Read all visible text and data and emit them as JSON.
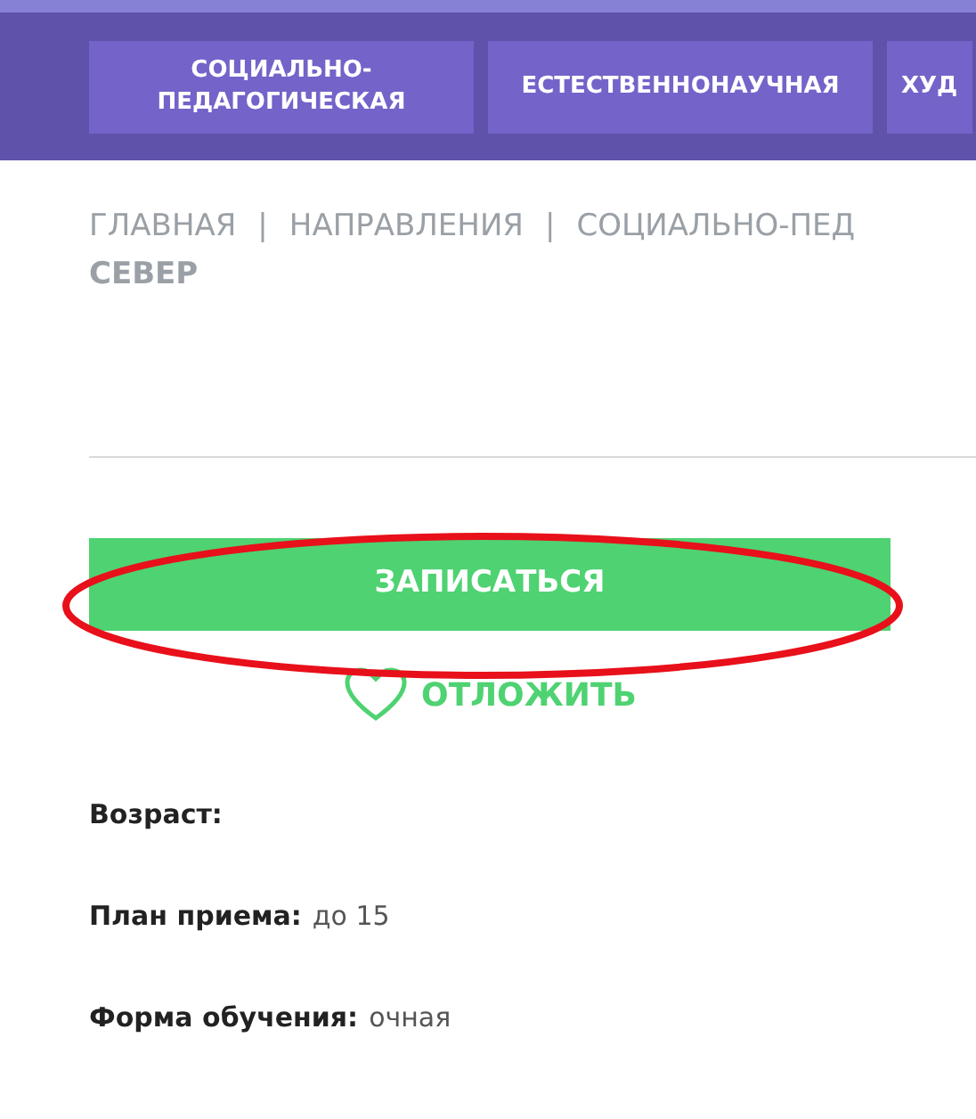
{
  "nav": {
    "tabs": [
      {
        "label": "СОЦИАЛЬНО-ПЕДАГОГИЧЕСКАЯ"
      },
      {
        "label": "ЕСТЕСТВЕННОНАУЧНАЯ"
      },
      {
        "label": "ХУД"
      }
    ]
  },
  "breadcrumb": {
    "items": [
      "ГЛАВНАЯ",
      "НАПРАВЛЕНИЯ",
      "СОЦИАЛЬНО-ПЕД"
    ],
    "separator": "|",
    "current": "СЕВЕР"
  },
  "enroll_button": "ЗАПИСАТЬСЯ",
  "postpone_link": "ОТЛОЖИТЬ",
  "details": [
    {
      "label": "Возраст:"
    },
    {
      "label": "План приема:",
      "value": "до 15"
    },
    {
      "label": "Форма обучения:",
      "value": "очная"
    }
  ]
}
